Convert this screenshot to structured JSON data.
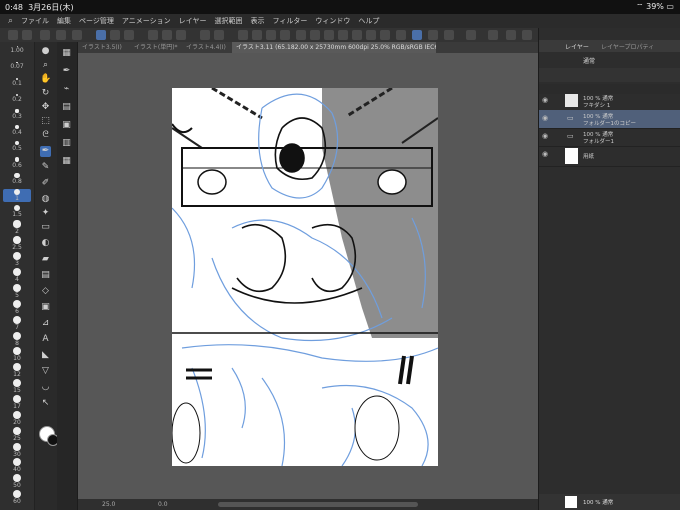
{
  "status": {
    "time": "0:48",
    "date": "3月26日(木)",
    "battery": "39%"
  },
  "menu": [
    "ファイル",
    "編集",
    "ページ管理",
    "アニメーション",
    "レイヤー",
    "選択範囲",
    "表示",
    "フィルター",
    "ウィンドウ",
    "ヘルプ"
  ],
  "tabs": [
    {
      "label": "イラスト3.5(I)"
    },
    {
      "label": "イラスト(単円)*"
    },
    {
      "label": "イラスト4.4(I)"
    },
    {
      "label": "イラスト3.11 (65.182.00 x 25730mm 600dpi 25.0% RGB/sRGB IEC61966-2.1)"
    }
  ],
  "brush_sizes": [
    "1.00",
    "0.07",
    "0.1",
    "0.2",
    "0.3",
    "0.4",
    "0.5",
    "0.6",
    "0.8",
    "1",
    "1.5",
    "2",
    "2.5",
    "3",
    "4",
    "5",
    "6",
    "7",
    "8",
    "10",
    "12",
    "15",
    "17",
    "20",
    "25",
    "30",
    "40",
    "50",
    "60"
  ],
  "layers_panel": {
    "title": "レイヤー",
    "title2": "レイヤープロパティ",
    "blend": "通常",
    "layers": [
      {
        "line1": "100 % 通常",
        "line2": "フキダシ 1",
        "type": "raster"
      },
      {
        "line1": "100 % 通常",
        "line2": "フォルダー1のコピー",
        "type": "folder",
        "selected": true
      },
      {
        "line1": "100 % 通常",
        "line2": "フォルダー1",
        "type": "folder"
      },
      {
        "line1": "",
        "line2": "用紙",
        "type": "paper"
      }
    ],
    "bottom_layer": "100 % 通常"
  },
  "bottom": {
    "zoom": "25.0",
    "angle": "0.0"
  },
  "colors": {
    "accent": "#3f6db3",
    "sketch": "#6f9ede"
  }
}
